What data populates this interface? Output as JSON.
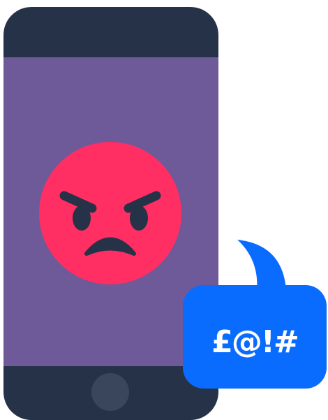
{
  "bubble": {
    "text": "£@!#"
  },
  "icons": {
    "phone": "smartphone-icon",
    "face": "angry-face-icon",
    "bubble": "speech-bubble-icon",
    "home_button": "home-button-icon"
  },
  "colors": {
    "phone_body": "#263247",
    "screen": "#6e5a99",
    "face": "#ff2e63",
    "face_features": "#263247",
    "home_button": "#3a465b",
    "bubble": "#0a6cff",
    "bubble_text": "#ffffff"
  }
}
